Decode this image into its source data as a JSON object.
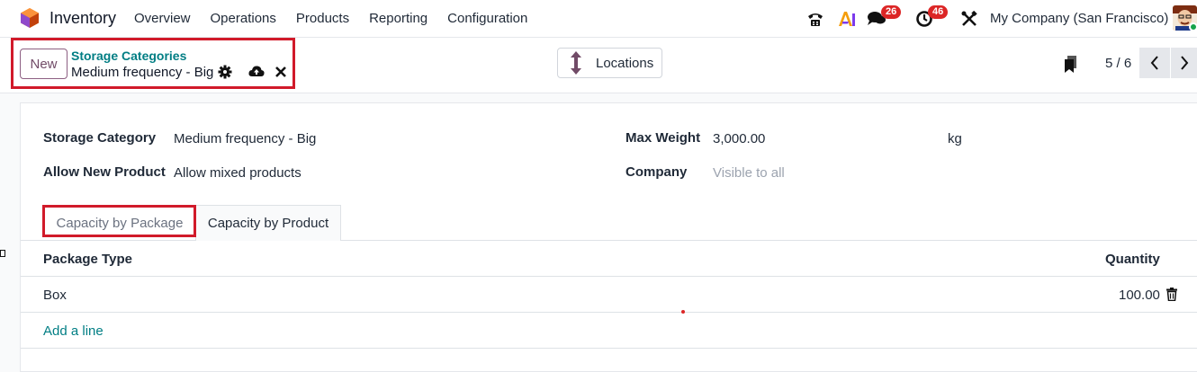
{
  "navbar": {
    "app_name": "Inventory",
    "menu": [
      "Overview",
      "Operations",
      "Products",
      "Reporting",
      "Configuration"
    ],
    "messages_badge": "26",
    "activities_badge": "46",
    "company": "My Company (San Francisco)"
  },
  "control": {
    "new_label": "New",
    "breadcrumb_parent": "Storage Categories",
    "record_name": "Medium frequency - Big",
    "locations_label": "Locations",
    "pager": "5 / 6"
  },
  "form": {
    "storage_category_label": "Storage Category",
    "storage_category_value": "Medium frequency - Big",
    "allow_new_product_label": "Allow New Product",
    "allow_new_product_value": "Allow mixed products",
    "max_weight_label": "Max Weight",
    "max_weight_value": "3,000.00",
    "max_weight_unit": "kg",
    "company_label": "Company",
    "company_placeholder": "Visible to all"
  },
  "tabs": [
    "Capacity by Package",
    "Capacity by Product"
  ],
  "table": {
    "col_package_type": "Package Type",
    "col_quantity": "Quantity",
    "rows": [
      {
        "package_type": "Box",
        "quantity": "100.00"
      }
    ],
    "add_line": "Add a line"
  },
  "colors": {
    "accent": "#714b67",
    "link": "#017e84",
    "badge": "#dc2626",
    "highlight": "#d11a2a"
  }
}
